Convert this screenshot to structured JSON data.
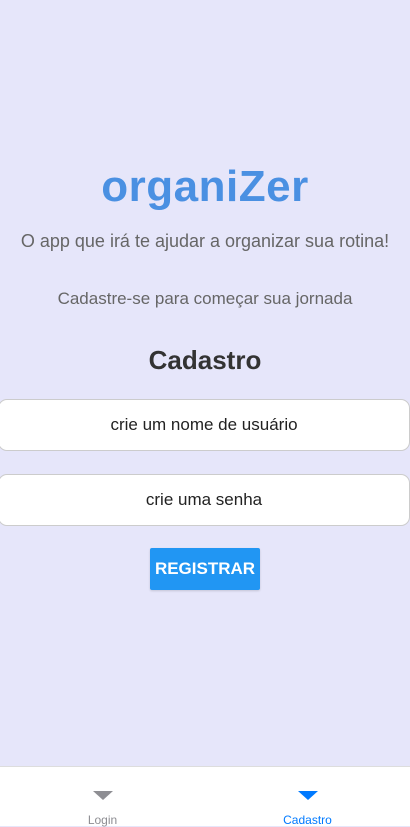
{
  "app": {
    "title": "organiZer",
    "tagline": "O app que irá te ajudar a organizar sua rotina!",
    "subtitle": "Cadastre-se para começar sua jornada"
  },
  "form": {
    "title": "Cadastro",
    "username_placeholder": "crie um nome de usuário",
    "username_value": "",
    "password_placeholder": "crie uma senha",
    "password_value": "",
    "register_label": "REGISTRAR"
  },
  "tabs": [
    {
      "label": "Login",
      "icon": "triangle-down-icon",
      "active": false
    },
    {
      "label": "Cadastro",
      "icon": "triangle-down-icon",
      "active": true
    }
  ],
  "colors": {
    "background": "#E6E6FA",
    "brand": "#4A90E2",
    "button": "#2196F3",
    "tab_active": "#007AFF",
    "tab_inactive": "#8E8E93"
  }
}
